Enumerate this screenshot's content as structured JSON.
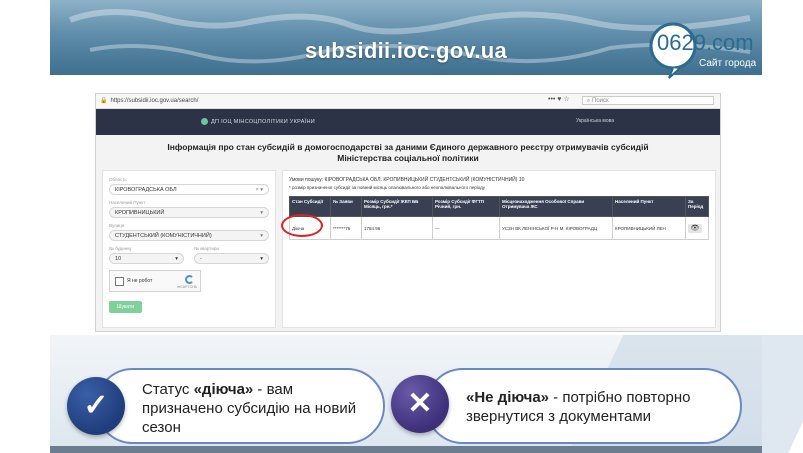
{
  "header": {
    "site_title": "subsidii.ioc.gov.ua",
    "logo_number": "0629.com",
    "logo_caption": "Сайт города"
  },
  "browser": {
    "url": "https://subsidii.ioc.gov.ua/search/",
    "url_menu": "••• ♥ ☆",
    "search_placeholder": "Поиск",
    "brand": "ДП ІОЦ МІНСОЦПОЛІТИКИ УКРАЇНИ",
    "lang_label": "Українська мова"
  },
  "page": {
    "title_line1": "Інформація про стан субсидій в домогосподарстві за даними Єдиного державного реєстру отримувачів субсидій",
    "title_line2": "Міністерства соціальної політики"
  },
  "filters": {
    "region_label": "Область",
    "region_value": "КІРОВОГРАДСЬКА ОБЛ",
    "city_label": "Населений Пункт",
    "city_value": "КРОПИВНИЦЬКИЙ",
    "street_label": "Вулиця",
    "street_value": "СТУДЕНТСЬКИЙ (КОМУНІСТИЧНИЙ)",
    "house_label": "№ будинку",
    "house_value": "10",
    "flat_label": "№ квартири",
    "flat_value": "-",
    "captcha_text": "Я не робот",
    "captcha_brand": "reCAPTCHA",
    "find_button": "Шукати"
  },
  "results": {
    "conditions": "Умови пошуку: КІРОВОГРАДСЬКА ОБЛ. КРОПИВНИЦЬКИЙ СТУДЕНТСЬКИЙ (КОМУНІСТИЧНИЙ) 10",
    "note": "* розмір призначеної субсидії за повний місяць опалювального або неопалювального періоду",
    "headers": [
      "Стан Субсидії",
      "№ Заяви",
      "Розмір Субсидії ЖКП ББ Місяць, грн.*",
      "Розмір Субсидії ФГТП Річний, грн.",
      "Місцезнаходження Особової Справи Отримувача ЖС",
      "Населений Пункт",
      "За Період"
    ],
    "row": [
      "Діюча",
      "*******76",
      "1784.96",
      "---",
      "УСЗН ВК ЛЕНІНСЬКОЇ Р-Н М. КІРОВОГРАДЦ",
      "КРОПИВНИЦЬКИЙ ЛЕН",
      "👁"
    ]
  },
  "info": {
    "active_text_1": "Статус ",
    "active_text_2": "«діюча»",
    "active_text_3": " - вам призначено субсидію на новий сезон",
    "inactive_text_1": "«Не діюча»",
    "inactive_text_2": " -  потрібно повторно звернутися з документами",
    "active_icon": "check-icon",
    "inactive_icon": "cross-icon"
  }
}
